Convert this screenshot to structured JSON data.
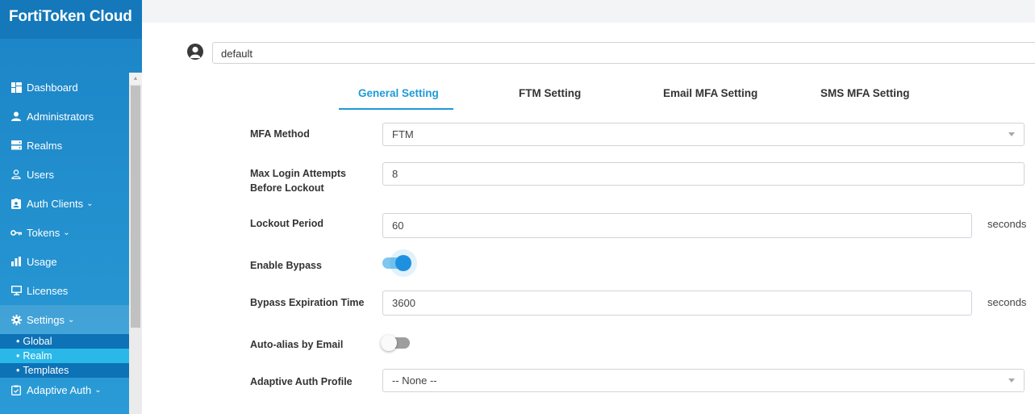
{
  "app": {
    "title": "FortiToken Cloud"
  },
  "sidebar": {
    "items": [
      {
        "label": "Dashboard",
        "icon": "dashboard-icon"
      },
      {
        "label": "Administrators",
        "icon": "person-icon"
      },
      {
        "label": "Realms",
        "icon": "server-icon"
      },
      {
        "label": "Users",
        "icon": "user-outline-icon"
      },
      {
        "label": "Auth Clients",
        "icon": "id-badge-icon",
        "expandable": true
      },
      {
        "label": "Tokens",
        "icon": "key-icon",
        "expandable": true
      },
      {
        "label": "Usage",
        "icon": "bar-chart-icon"
      },
      {
        "label": "Licenses",
        "icon": "monitor-icon"
      },
      {
        "label": "Settings",
        "icon": "gear-icon",
        "expandable": true,
        "active": true
      },
      {
        "label": "Adaptive Auth",
        "icon": "clipboard-icon",
        "expandable": true
      }
    ],
    "settings_sub": [
      {
        "label": "Global"
      },
      {
        "label": "Realm",
        "selected": true
      },
      {
        "label": "Templates"
      }
    ],
    "chevron": "⌄"
  },
  "realm": {
    "value": "default"
  },
  "tabs": [
    {
      "label": "General Setting",
      "active": true
    },
    {
      "label": "FTM Setting"
    },
    {
      "label": "Email MFA Setting"
    },
    {
      "label": "SMS MFA Setting"
    }
  ],
  "form": {
    "mfa_method": {
      "label": "MFA Method",
      "value": "FTM"
    },
    "max_login": {
      "label_line1": "Max Login Attempts",
      "label_line2": "Before Lockout",
      "value": "8"
    },
    "lockout_period": {
      "label": "Lockout Period",
      "value": "60",
      "suffix": "seconds"
    },
    "enable_bypass": {
      "label": "Enable Bypass",
      "enabled": true
    },
    "bypass_expiration": {
      "label": "Bypass Expiration Time",
      "value": "3600",
      "suffix": "seconds"
    },
    "auto_alias": {
      "label": "Auto-alias by Email",
      "enabled": false
    },
    "adaptive_auth_profile": {
      "label": "Adaptive Auth Profile",
      "value": "-- None --"
    }
  },
  "colors": {
    "sidebar": "#1b84c6",
    "accent": "#1f9ad6",
    "selected_sub": "#29b8e8",
    "toggle_on": "#1e90e0"
  }
}
